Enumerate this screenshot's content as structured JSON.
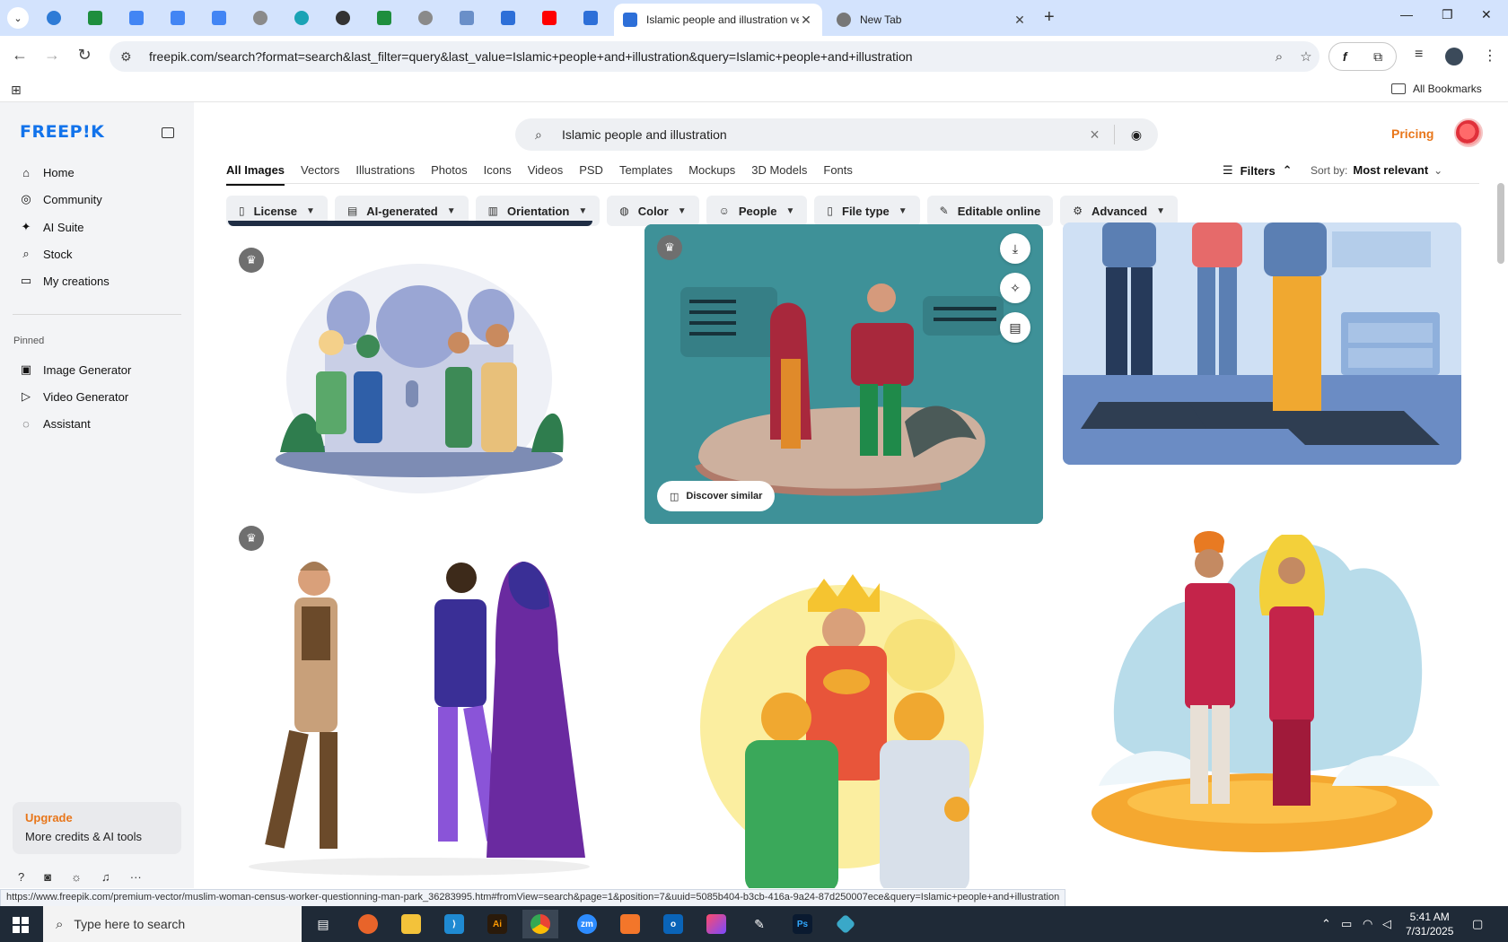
{
  "browser": {
    "tabs": [
      {
        "title": "Islamic people and illustration vectors",
        "active": true
      },
      {
        "title": "New Tab",
        "active": false
      }
    ],
    "url": "freepik.com/search?format=search&last_filter=query&last_value=Islamic+people+and+illustration&query=Islamic+people+and+illustration",
    "bookmarks_label": "All Bookmarks",
    "status_url": "https://www.freepik.com/premium-vector/muslim-woman-census-worker-questionning-man-park_36283995.htm#fromView=search&page=1&position=7&uuid=5085b404-b3cb-416a-9a24-87d250007ece&query=Islamic+people+and+illustration"
  },
  "sidebar": {
    "logo": "FREEP!K",
    "nav": [
      {
        "label": "Home",
        "icon": "home-icon"
      },
      {
        "label": "Community",
        "icon": "globe-icon"
      },
      {
        "label": "AI Suite",
        "icon": "sparkle-icon"
      },
      {
        "label": "Stock",
        "icon": "search-icon"
      },
      {
        "label": "My creations",
        "icon": "folder-icon"
      }
    ],
    "pinned_label": "Pinned",
    "pinned": [
      {
        "label": "Image Generator",
        "icon": "image-icon"
      },
      {
        "label": "Video Generator",
        "icon": "video-icon"
      },
      {
        "label": "Assistant",
        "icon": "chat-icon"
      }
    ],
    "upgrade": {
      "title": "Upgrade",
      "subtitle": "More credits & AI tools"
    }
  },
  "header": {
    "search_query": "Islamic people and illustration",
    "pricing": "Pricing"
  },
  "type_tabs": [
    "All Images",
    "Vectors",
    "Illustrations",
    "Photos",
    "Icons",
    "Videos",
    "PSD",
    "Templates",
    "Mockups",
    "3D Models",
    "Fonts"
  ],
  "filters_label": "Filters",
  "sort": {
    "label": "Sort by:",
    "value": "Most relevant"
  },
  "chips": [
    {
      "label": "License",
      "icon": "license-icon"
    },
    {
      "label": "AI-generated",
      "icon": "ai-icon"
    },
    {
      "label": "Orientation",
      "icon": "orientation-icon"
    },
    {
      "label": "Color",
      "icon": "palette-icon"
    },
    {
      "label": "People",
      "icon": "people-icon"
    },
    {
      "label": "File type",
      "icon": "file-icon"
    },
    {
      "label": "Editable online",
      "icon": "pen-icon"
    },
    {
      "label": "Advanced",
      "icon": "gear-icon"
    }
  ],
  "discover_similar": "Discover similar",
  "taskbar": {
    "search_placeholder": "Type here to search",
    "time": "5:41 AM",
    "date": "7/31/2025"
  }
}
